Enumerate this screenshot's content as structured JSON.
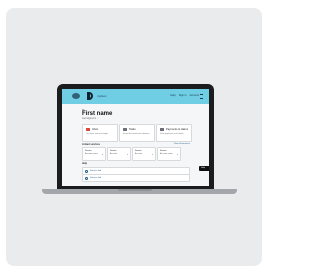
{
  "app": {
    "brand": "myGov",
    "nav": [
      "Help",
      "Sign in",
      "Account"
    ]
  },
  "page": {
    "greeting": "Hi,",
    "title": "First name",
    "subtitle": "Last signed in ..."
  },
  "tiles": [
    {
      "label": "Inbox",
      "desc": "You have new messages",
      "color": "#d94a3a"
    },
    {
      "label": "Tasks",
      "desc": "Items that need your attention",
      "color": "#6a6f75"
    },
    {
      "label": "Payments & claims",
      "desc": "View payments and claims",
      "color": "#6a6f75"
    }
  ],
  "section": {
    "title": "Linked services",
    "link": "View all services"
  },
  "accounts": [
    {
      "label": "Service",
      "value": "Account name"
    },
    {
      "label": "Service",
      "value": "Account"
    },
    {
      "label": "Service",
      "value": "Account"
    },
    {
      "label": "Service",
      "value": "Account name"
    }
  ],
  "list": {
    "title": "Help",
    "items": [
      "Service link",
      "Service link"
    ]
  },
  "side_button": "Help"
}
